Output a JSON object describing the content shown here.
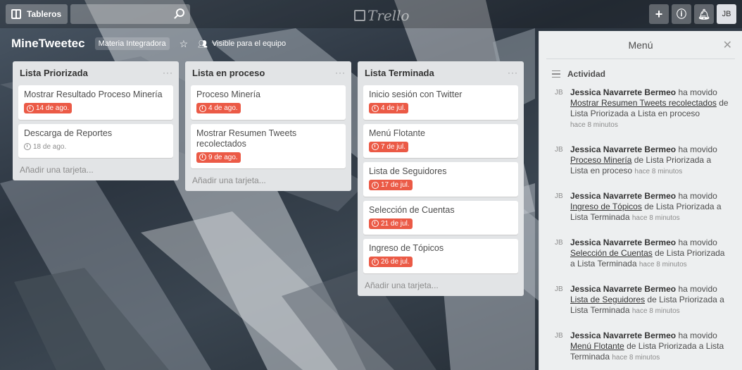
{
  "header": {
    "boards_label": "Tableros",
    "logo_text": "Trello",
    "user_initials": "JB"
  },
  "board": {
    "title": "MineTweetec",
    "tag": "Materia Integradora",
    "visibility": "Visible para el equipo"
  },
  "lists": [
    {
      "title": "Lista Priorizada",
      "cards": [
        {
          "title": "Mostrar Resultado Proceso Minería",
          "due": "14 de ago.",
          "overdue": true
        },
        {
          "title": "Descarga de Reportes",
          "due": "18 de ago.",
          "overdue": false
        }
      ],
      "add_label": "Añadir una tarjeta..."
    },
    {
      "title": "Lista en proceso",
      "cards": [
        {
          "title": "Proceso Minería",
          "due": "4 de ago.",
          "overdue": true
        },
        {
          "title": "Mostrar Resumen Tweets recolectados",
          "due": "9 de ago.",
          "overdue": true
        }
      ],
      "add_label": "Añadir una tarjeta..."
    },
    {
      "title": "Lista Terminada",
      "cards": [
        {
          "title": "Inicio sesión con Twitter",
          "due": "4 de jul.",
          "overdue": true
        },
        {
          "title": "Menú Flotante",
          "due": "7 de jul.",
          "overdue": true
        },
        {
          "title": "Lista de Seguidores",
          "due": "17 de jul.",
          "overdue": true
        },
        {
          "title": "Selección de Cuentas",
          "due": "21 de jul.",
          "overdue": true
        },
        {
          "title": "Ingreso de Tópicos",
          "due": "26 de jul.",
          "overdue": true
        }
      ],
      "add_label": "Añadir una tarjeta..."
    }
  ],
  "menu": {
    "title": "Menú",
    "activity_title": "Actividad",
    "items": [
      {
        "avatar": "JB",
        "user": "Jessica Navarrete Bermeo",
        "action": "ha movido",
        "card": "Mostrar Resumen Tweets recolectados",
        "detail": "de Lista Priorizada a Lista en proceso",
        "time": "hace 8 minutos"
      },
      {
        "avatar": "JB",
        "user": "Jessica Navarrete Bermeo",
        "action": "ha movido",
        "card": "Proceso Minería",
        "detail": "de Lista Priorizada a Lista en proceso",
        "time": "hace 8 minutos"
      },
      {
        "avatar": "JB",
        "user": "Jessica Navarrete Bermeo",
        "action": "ha movido",
        "card": "Ingreso de Tópicos",
        "detail": "de Lista Priorizada a Lista Terminada",
        "time": "hace 8 minutos"
      },
      {
        "avatar": "JB",
        "user": "Jessica Navarrete Bermeo",
        "action": "ha movido",
        "card": "Selección de Cuentas",
        "detail": "de Lista Priorizada a Lista Terminada",
        "time": "hace 8 minutos"
      },
      {
        "avatar": "JB",
        "user": "Jessica Navarrete Bermeo",
        "action": "ha movido",
        "card": "Lista de Seguidores",
        "detail": "de Lista Priorizada a Lista Terminada",
        "time": "hace 8 minutos"
      },
      {
        "avatar": "JB",
        "user": "Jessica Navarrete Bermeo",
        "action": "ha movido",
        "card": "Menú Flotante",
        "detail": "de Lista Priorizada a Lista Terminada",
        "time": "hace 8 minutos"
      }
    ]
  },
  "colors": {
    "overdue": "#eb5a46",
    "list_bg": "#e2e4e6",
    "menu_bg": "#edeff0"
  }
}
